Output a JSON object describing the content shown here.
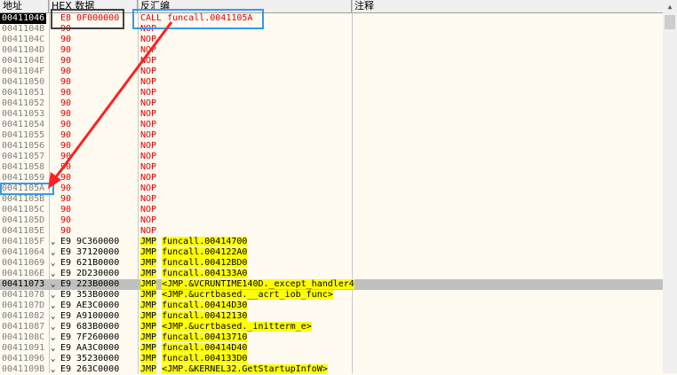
{
  "header": {
    "address_label": "地址",
    "bytes_label": "HEX 数据",
    "disasm_label": "反汇编",
    "comment_label": "注释"
  },
  "scrollbar": {
    "up_glyph": "▲"
  },
  "rows": [
    {
      "address": "00411046",
      "bytes": "E8 0F000000",
      "disasm": "CALL funcall.0041105A",
      "style": "cur",
      "red": true
    },
    {
      "address": "0041104B",
      "bytes": "90",
      "disasm": "NOP",
      "red": true
    },
    {
      "address": "0041104C",
      "bytes": "90",
      "disasm": "NOP",
      "red": true
    },
    {
      "address": "0041104D",
      "bytes": "90",
      "disasm": "NOP",
      "red": true
    },
    {
      "address": "0041104E",
      "bytes": "90",
      "disasm": "NOP",
      "red": true
    },
    {
      "address": "0041104F",
      "bytes": "90",
      "disasm": "NOP",
      "red": true
    },
    {
      "address": "00411050",
      "bytes": "90",
      "disasm": "NOP",
      "red": true
    },
    {
      "address": "00411051",
      "bytes": "90",
      "disasm": "NOP",
      "red": true
    },
    {
      "address": "00411052",
      "bytes": "90",
      "disasm": "NOP",
      "red": true
    },
    {
      "address": "00411053",
      "bytes": "90",
      "disasm": "NOP",
      "red": true
    },
    {
      "address": "00411054",
      "bytes": "90",
      "disasm": "NOP",
      "red": true
    },
    {
      "address": "00411055",
      "bytes": "90",
      "disasm": "NOP",
      "red": true
    },
    {
      "address": "00411056",
      "bytes": "90",
      "disasm": "NOP",
      "red": true
    },
    {
      "address": "00411057",
      "bytes": "90",
      "disasm": "NOP",
      "red": true
    },
    {
      "address": "00411058",
      "bytes": "90",
      "disasm": "NOP",
      "red": true
    },
    {
      "address": "00411059",
      "bytes": "90",
      "disasm": "NOP",
      "red": true
    },
    {
      "address": "0041105A",
      "bytes": "90",
      "disasm": "NOP",
      "red": true
    },
    {
      "address": "0041105B",
      "bytes": "90",
      "disasm": "NOP",
      "red": true
    },
    {
      "address": "0041105C",
      "bytes": "90",
      "disasm": "NOP",
      "red": true
    },
    {
      "address": "0041105D",
      "bytes": "90",
      "disasm": "NOP",
      "red": true
    },
    {
      "address": "0041105E",
      "bytes": "90",
      "disasm": "NOP",
      "red": true
    },
    {
      "address": "0041105F",
      "mark": "⌄",
      "bytes": "E9 9C360000",
      "op": "JMP",
      "arg": "funcall.00414700"
    },
    {
      "address": "00411064",
      "mark": "⌄",
      "bytes": "E9 37120000",
      "op": "JMP",
      "arg": "funcall.004122A0"
    },
    {
      "address": "00411069",
      "mark": "⌄",
      "bytes": "E9 621B0000",
      "op": "JMP",
      "arg": "funcall.00412BD0"
    },
    {
      "address": "0041106E",
      "mark": "⌄",
      "bytes": "E9 2D230000",
      "op": "JMP",
      "arg": "funcall.004133A0"
    },
    {
      "address": "00411073",
      "mark": "⌄",
      "bytes": "E9 223B0000",
      "op": "JMP",
      "arg": "<JMP.&VCRUNTIME140D._except_handler4",
      "style": "sel"
    },
    {
      "address": "00411078",
      "mark": "⌄",
      "bytes": "E9 353B0000",
      "op": "JMP",
      "arg": "<JMP.&ucrtbased.__acrt_iob_func>"
    },
    {
      "address": "0041107D",
      "mark": "⌄",
      "bytes": "E9 AE3C0000",
      "op": "JMP",
      "arg": "funcall.00414D30"
    },
    {
      "address": "00411082",
      "mark": "⌄",
      "bytes": "E9 A9100000",
      "op": "JMP",
      "arg": "funcall.00412130"
    },
    {
      "address": "00411087",
      "mark": "⌄",
      "bytes": "E9 683B0000",
      "op": "JMP",
      "arg": "<JMP.&ucrtbased._initterm_e>"
    },
    {
      "address": "0041108C",
      "mark": "⌄",
      "bytes": "E9 7F260000",
      "op": "JMP",
      "arg": "funcall.00413710"
    },
    {
      "address": "00411091",
      "mark": "⌄",
      "bytes": "E9 AA3C0000",
      "op": "JMP",
      "arg": "funcall.00414D40"
    },
    {
      "address": "00411096",
      "mark": "⌄",
      "bytes": "E9 35230000",
      "op": "JMP",
      "arg": "funcall.004133D0"
    },
    {
      "address": "0041109B",
      "mark": "⌄",
      "bytes": "E9 263C0000",
      "op": "JMP",
      "arg": "<JMP.&KERNEL32.GetStartupInfoW>"
    }
  ],
  "annotations": {
    "box_color": "#3399ee",
    "dark_box_color": "#404040",
    "arrow_color": "#ff2020"
  }
}
